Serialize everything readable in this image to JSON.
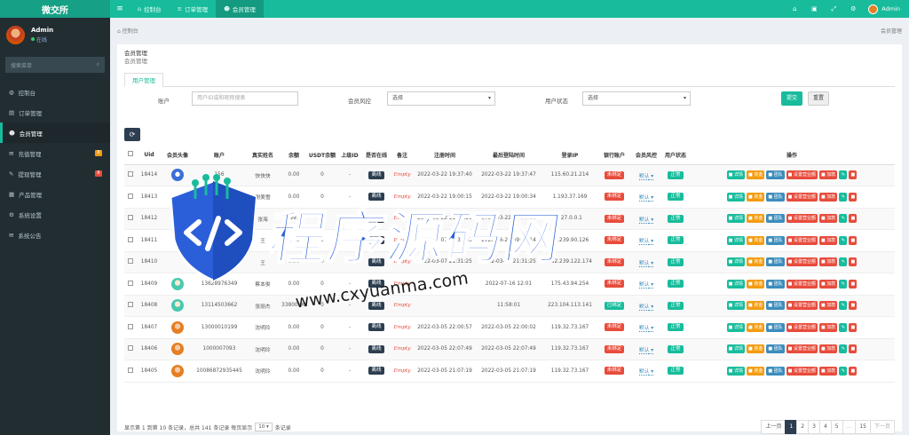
{
  "app": {
    "logo": "微交所",
    "menu_toggle": "≡",
    "top_tabs": [
      {
        "icon": "⌂",
        "label": "控制台",
        "active": false
      },
      {
        "icon": "≡",
        "label": "订单管理",
        "active": false
      },
      {
        "icon": "☻",
        "label": "会员管理",
        "active": true
      }
    ],
    "top_icons": [
      "⌂",
      "▣",
      "⤢",
      "⚙"
    ],
    "top_user": "Admin"
  },
  "sidebar": {
    "user_name": "Admin",
    "user_status": "在线",
    "search_placeholder": "搜索菜单",
    "search_icon": "⌕",
    "items": [
      {
        "icon": "◍",
        "label": "控制台",
        "active": false,
        "badge": ""
      },
      {
        "icon": "▤",
        "label": "订单管理",
        "active": false,
        "badge": ""
      },
      {
        "icon": "☻",
        "label": "会员管理",
        "active": true,
        "badge": ""
      },
      {
        "icon": "✉",
        "label": "充值管理",
        "active": false,
        "badge": "8",
        "badge_color": "#f39c12"
      },
      {
        "icon": "✎",
        "label": "提现管理",
        "active": false,
        "badge": "8",
        "badge_color": "#e74c3c"
      },
      {
        "icon": "▦",
        "label": "产品管理",
        "active": false,
        "badge": ""
      },
      {
        "icon": "⚙",
        "label": "系统设置",
        "active": false,
        "badge": ""
      },
      {
        "icon": "✉",
        "label": "系统公告",
        "active": false,
        "badge": ""
      }
    ]
  },
  "breadcrumb": {
    "left": "控制台",
    "right": "会员管理"
  },
  "panel": {
    "title": "会员管理",
    "subtitle": "会员管理",
    "tab": "用户管理"
  },
  "filters": {
    "account_label": "账户",
    "account_placeholder": "用户ID或和昵称搜索",
    "risk_label": "会员风控",
    "risk_value": "选择",
    "status_label": "用户状态",
    "status_value": "选择",
    "submit": "提交",
    "reset": "重置"
  },
  "table": {
    "headers": [
      "",
      "Uid",
      "会员头像",
      "账户",
      "真实姓名",
      "余额",
      "USDT余额",
      "上级ID",
      "是否在线",
      "备注",
      "注册时间",
      "最后登陆时间",
      "登录IP",
      "银行账户",
      "会员风控",
      "用户状态",
      "操作"
    ],
    "rows": [
      {
        "uid": "18414",
        "avatar": "blue",
        "account": "156",
        "name": "快快快",
        "balance": "0.00",
        "usdt": "0",
        "parent": "-",
        "online": "离线",
        "remark": "Empty",
        "reg": "2022-03-22 19:37:40",
        "last": "2022-03-22 19:37:47",
        "ip": "115.60.21.214",
        "bank": "未绑定",
        "risk": "默认",
        "status": "正常"
      },
      {
        "uid": "18413",
        "avatar": "none",
        "account": "",
        "name": "谢美雪",
        "balance": "0.00",
        "usdt": "0",
        "parent": "-",
        "online": "离线",
        "remark": "Empty",
        "reg": "2022-03-22 19:00:15",
        "last": "2022-03-22 19:00:34",
        "ip": "1.193.37.169",
        "bank": "未绑定",
        "risk": "默认",
        "status": "正常"
      },
      {
        "uid": "18412",
        "avatar": "none",
        "account": "",
        "name": "张海",
        "balance": "9999.00",
        "usdt": "0",
        "parent": "-",
        "online": "离线",
        "remark": "Empty",
        "reg": "2022-03-22 11:10:29",
        "last": "2022-03-22 19:31:21",
        "ip": "127.0.0.1",
        "bank": "未绑定",
        "risk": "默认",
        "status": "正常"
      },
      {
        "uid": "18411",
        "avatar": "none",
        "account": "",
        "name": "王",
        "balance": "0.00",
        "usdt": "0",
        "parent": "-",
        "online": "离线",
        "remark": "Empty",
        "reg": "2022-03-07 21:30:43",
        "last": "2022-16-22 09:01:14",
        "ip": "20.239.90.126",
        "bank": "未绑定",
        "risk": "默认",
        "status": "正常"
      },
      {
        "uid": "18410",
        "avatar": "none",
        "account": "4344",
        "name": "王",
        "balance": "0.00",
        "usdt": "0",
        "parent": "-",
        "online": "离线",
        "remark": "Empty",
        "reg": "2022-03-07 21:31:25",
        "last": "2022-03-07 21:31:25",
        "ip": "182.239.122.174",
        "bank": "未绑定",
        "risk": "默认",
        "status": "正常"
      },
      {
        "uid": "18409",
        "avatar": "teal",
        "account": "13628976349",
        "name": "蔡本俊",
        "balance": "0.00",
        "usdt": "0",
        "parent": "-",
        "online": "离线",
        "remark": "Empty",
        "reg": "",
        "last": "2022-07-16 12:01",
        "ip": "175.43.94.254",
        "bank": "未绑定",
        "risk": "默认",
        "status": "正常"
      },
      {
        "uid": "18408",
        "avatar": "teal",
        "account": "13114503662",
        "name": "张丽杰",
        "balance": "33800.00",
        "usdt": "0",
        "parent": "-",
        "online": "离线",
        "remark": "Empty",
        "reg": "",
        "last": "11:58:01",
        "ip": "223.104.113.141",
        "bank": "已绑定",
        "risk": "默认",
        "status": "正常"
      },
      {
        "uid": "18407",
        "avatar": "orange",
        "account": "13000010199",
        "name": "沈明玲",
        "balance": "0.00",
        "usdt": "0",
        "parent": "-",
        "online": "离线",
        "remark": "Empty",
        "reg": "2022-03-05 22:00:57",
        "last": "2022-03-05 22:00:02",
        "ip": "119.32.73.167",
        "bank": "未绑定",
        "risk": "默认",
        "status": "正常"
      },
      {
        "uid": "18406",
        "avatar": "orange",
        "account": "1000007093",
        "name": "沈明玲",
        "balance": "0.00",
        "usdt": "0",
        "parent": "-",
        "online": "离线",
        "remark": "Empty",
        "reg": "2022-03-05 22:07:49",
        "last": "2022-03-05 22:07:49",
        "ip": "119.32.73.167",
        "bank": "未绑定",
        "risk": "默认",
        "status": "正常"
      },
      {
        "uid": "18405",
        "avatar": "orange",
        "account": "10086872935445",
        "name": "沈明玲",
        "balance": "0.00",
        "usdt": "0",
        "parent": "-",
        "online": "离线",
        "remark": "Empty",
        "reg": "2022-03-05 21:07:19",
        "last": "2022-03-05 21:07:19",
        "ip": "119.32.73.167",
        "bank": "未绑定",
        "risk": "默认",
        "status": "正常"
      }
    ],
    "ops": [
      {
        "label": "■ 详情",
        "color": "#18bc9c"
      },
      {
        "label": "■ 资金",
        "color": "#f39c12"
      },
      {
        "label": "■ 团队",
        "color": "#3c8dbc"
      },
      {
        "label": "■ 设置营业额",
        "color": "#e74c3c"
      },
      {
        "label": "■ 加款",
        "color": "#e74c3c"
      },
      {
        "label": "✎",
        "color": "#18bc9c"
      },
      {
        "label": "■",
        "color": "#e74c3c"
      }
    ]
  },
  "footer": {
    "info_prefix": "显示第 1 到第 10 条记录，总共 141 条记录 每页显示",
    "page_size": "10",
    "info_suffix": "条记录"
  },
  "pager": {
    "prev": "上一页",
    "pages": [
      "1",
      "2",
      "3",
      "4",
      "5",
      "...",
      "15"
    ],
    "next": "下一页"
  },
  "watermark": {
    "text": "程序源码网",
    "url": "www.cxyuanma.com"
  }
}
